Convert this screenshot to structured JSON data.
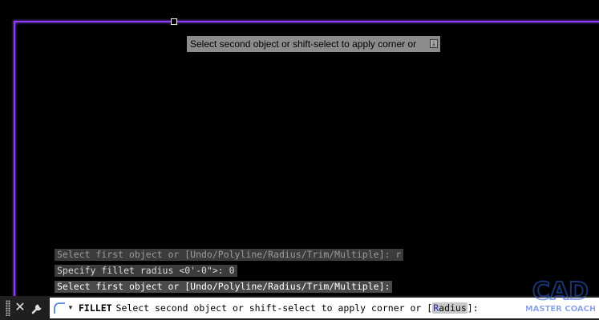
{
  "viewport": {
    "tooltip_text": "Select second object or shift-select to apply corner or",
    "tooltip_icon": "download-arrow-icon",
    "history": [
      "Select first object or [Undo/Polyline/Radius/Trim/Multiple]: r",
      "Specify fillet radius <0'-0\">: 0",
      "Select first object or [Undo/Polyline/Radius/Trim/Multiple]:"
    ],
    "polyline_color": "#8a3cff"
  },
  "command_bar": {
    "close_icon": "close-icon",
    "customize_icon": "wrench-icon",
    "recent_icon": "fillet-arc-icon",
    "command_name": "FILLET",
    "prompt_before": "Select second object or shift-select to apply corner or [",
    "option_key": "R",
    "option_rest": "adius",
    "prompt_after": "]:"
  },
  "watermark": {
    "line1": "CAD",
    "line2": "MASTER COACH",
    "color": "#2f5fd0"
  }
}
